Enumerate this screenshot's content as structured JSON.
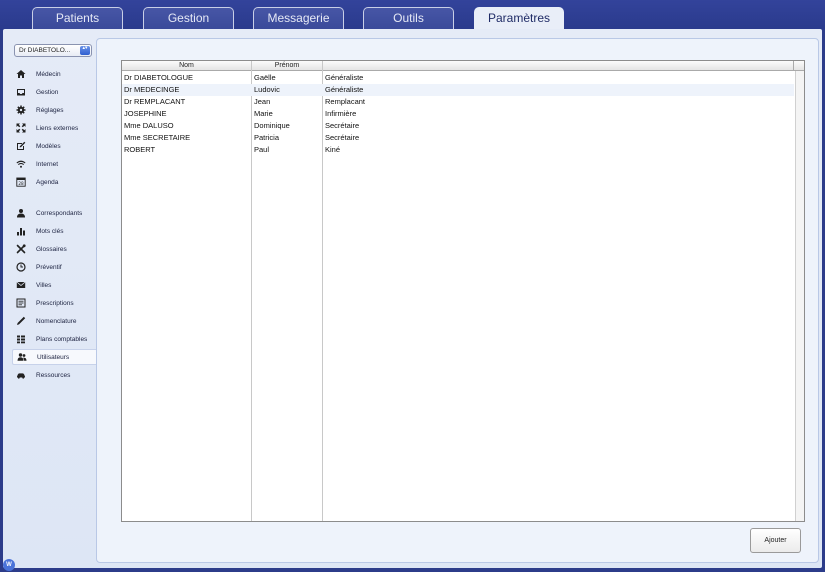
{
  "tabs": [
    {
      "label": "Patients"
    },
    {
      "label": "Gestion"
    },
    {
      "label": "Messagerie"
    },
    {
      "label": "Outils"
    },
    {
      "label": "Paramètres",
      "active": true
    }
  ],
  "user_select": {
    "value": "Dr DIABETOLO...",
    "stepper": "▴▾"
  },
  "sidebar": {
    "items": [
      {
        "label": "Médecin",
        "icon": "house-icon"
      },
      {
        "label": "Gestion",
        "icon": "tray-icon"
      },
      {
        "label": "Réglages",
        "icon": "gear-icon"
      },
      {
        "label": "Liens externes",
        "icon": "expand-icon"
      },
      {
        "label": "Modèles",
        "icon": "edit-icon"
      },
      {
        "label": "Internet",
        "icon": "wifi-icon"
      },
      {
        "label": "Agenda",
        "icon": "calendar-icon",
        "badge": "28"
      },
      {
        "label": "Correspondants",
        "icon": "person-icon"
      },
      {
        "label": "Mots clés",
        "icon": "bar-chart-icon"
      },
      {
        "label": "Glossaires",
        "icon": "tools-icon"
      },
      {
        "label": "Préventif",
        "icon": "clock-icon"
      },
      {
        "label": "Villes",
        "icon": "envelope-icon"
      },
      {
        "label": "Prescriptions",
        "icon": "document-icon"
      },
      {
        "label": "Nomenclature",
        "icon": "pencil-icon"
      },
      {
        "label": "Plans comptables",
        "icon": "list-icon"
      },
      {
        "label": "Utilisateurs",
        "icon": "users-icon",
        "selected": true
      },
      {
        "label": "Ressources",
        "icon": "car-icon"
      }
    ]
  },
  "table": {
    "columns": [
      "Nom",
      "Prénom",
      ""
    ],
    "rows": [
      [
        "Dr DIABETOLOGUE",
        "Gaëlle",
        "Généraliste"
      ],
      [
        "Dr MEDECINGE",
        "Ludovic",
        "Généraliste"
      ],
      [
        "Dr REMPLACANT",
        "Jean",
        "Remplacant"
      ],
      [
        "JOSEPHINE",
        "Marie",
        "Infirmière"
      ],
      [
        "Mme DALUSO",
        "Dominique",
        "Secrétaire"
      ],
      [
        "Mme SECRETAIRE",
        "Patricia",
        "Secrétaire"
      ],
      [
        "ROBERT",
        "Paul",
        "Kiné"
      ]
    ]
  },
  "buttons": {
    "add_label": "Ajouter"
  },
  "corner_badge": "W",
  "colors": {
    "tabbar": "#2c3c8a",
    "window": "#e5ebf7",
    "selection_row": "#eef3fb"
  }
}
